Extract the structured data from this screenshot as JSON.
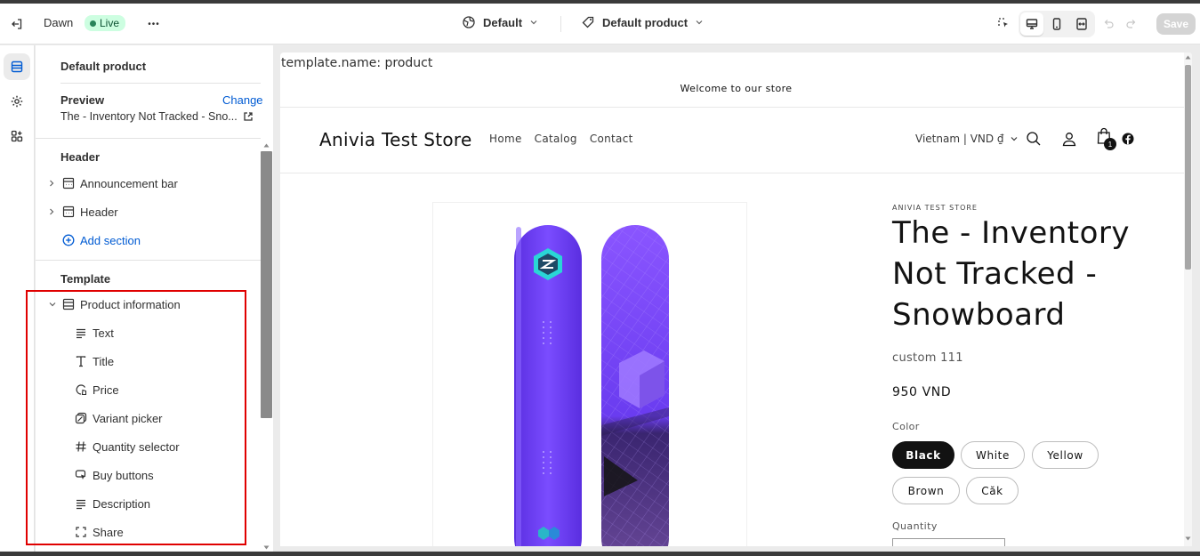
{
  "topbar": {
    "theme_name": "Dawn",
    "status": "Live",
    "more": "•••",
    "template_selector": "Default",
    "product_selector": "Default product",
    "save_label": "Save"
  },
  "sidebar": {
    "title": "Default product",
    "preview_label": "Preview",
    "change_label": "Change",
    "preview_value": "The - Inventory Not Tracked - Sno...",
    "header_group": "Header",
    "header_items": [
      "Announcement bar",
      "Header"
    ],
    "add_section": "Add section",
    "template_group": "Template",
    "product_information": "Product information",
    "blocks": [
      {
        "label": "Text",
        "icon": "text-lines-icon"
      },
      {
        "label": "Title",
        "icon": "title-t-icon"
      },
      {
        "label": "Price",
        "icon": "price-tag-icon"
      },
      {
        "label": "Variant picker",
        "icon": "variant-icon"
      },
      {
        "label": "Quantity selector",
        "icon": "hash-icon"
      },
      {
        "label": "Buy buttons",
        "icon": "buy-cursor-icon"
      },
      {
        "label": "Description",
        "icon": "description-lines-icon"
      },
      {
        "label": "Share",
        "icon": "share-frame-icon"
      }
    ]
  },
  "preview": {
    "template_name": "template.name: product",
    "announcement": "Welcome to our store",
    "store_name": "Anivia Test Store",
    "nav": [
      "Home",
      "Catalog",
      "Contact"
    ],
    "locale": "Vietnam | VND ₫",
    "cart_count": "1",
    "vendor": "ANIVIA TEST STORE",
    "product_title": "The - Inventory Not Tracked - Snowboard",
    "subtitle": "custom 111",
    "price": "950 VND",
    "color_label": "Color",
    "colors": [
      "Black",
      "White",
      "Yellow",
      "Brown",
      "Căk"
    ],
    "selected_color": "Black",
    "quantity_label": "Quantity"
  },
  "colors": {
    "accent_blue": "#005bd3",
    "live_bg": "#cdfee1",
    "highlight_red": "#e00000",
    "board_purple": "#6a3cf0"
  }
}
